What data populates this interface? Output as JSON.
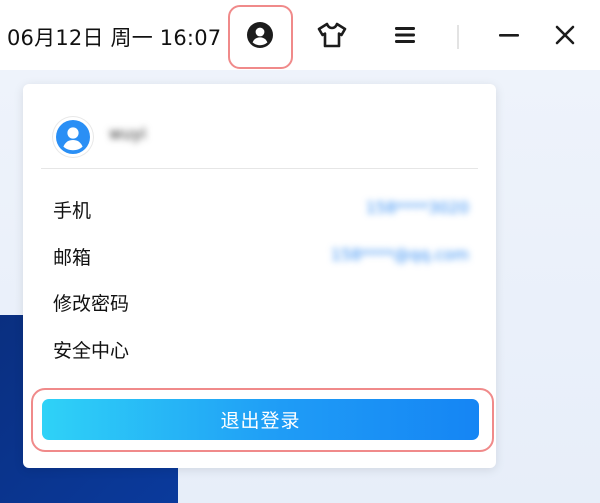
{
  "titlebar": {
    "datetime": "06月12日 周一 16:07",
    "icons": {
      "user": "user-circle-icon",
      "skin": "tshirt-icon",
      "menu": "hamburger-menu-icon",
      "minimize": "minimize-icon",
      "close": "close-icon"
    }
  },
  "profile": {
    "username": "wuyi"
  },
  "rows": [
    {
      "label": "手机",
      "value": "158****3020"
    },
    {
      "label": "邮箱",
      "value": "158****@qq.com"
    },
    {
      "label": "修改密码"
    },
    {
      "label": "安全中心"
    }
  ],
  "logout_label": "退出登录",
  "colors": {
    "accent": "#1f9cf6",
    "highlight_ring": "#f08a8a",
    "link_blue": "#2f8af2",
    "bg_navy": "#0a2f80"
  }
}
